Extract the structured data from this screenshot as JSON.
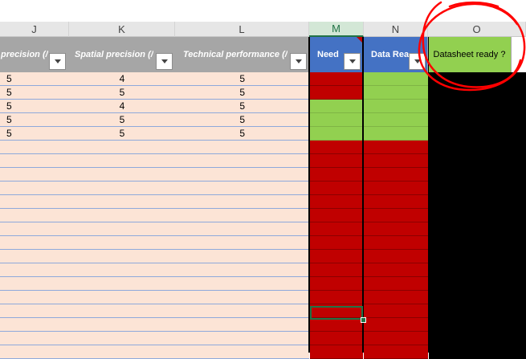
{
  "columns": [
    "J",
    "K",
    "L",
    "M",
    "N",
    "O"
  ],
  "headers": {
    "j": "precision (/",
    "k": "Spatial precision (/",
    "l": "Technical performance (/",
    "m": "Need",
    "n": "Data Rea",
    "o": "Datasheet ready ?"
  },
  "rows": [
    {
      "j": "5",
      "k": "4",
      "l": "5",
      "m": "red",
      "n": "green"
    },
    {
      "j": "5",
      "k": "5",
      "l": "5",
      "m": "red",
      "n": "green"
    },
    {
      "j": "5",
      "k": "4",
      "l": "5",
      "m": "green",
      "n": "green"
    },
    {
      "j": "5",
      "k": "5",
      "l": "5",
      "m": "green",
      "n": "green"
    },
    {
      "j": "5",
      "k": "5",
      "l": "5",
      "m": "green",
      "n": "green"
    }
  ],
  "colors": {
    "header_grey": "#a6a6a6",
    "header_blue": "#4472c4",
    "header_green": "#92d050",
    "salmon": "#fce4d6",
    "red": "#c00000",
    "green": "#92d050",
    "annotation_red": "#ff0000"
  },
  "selected_column": "M"
}
